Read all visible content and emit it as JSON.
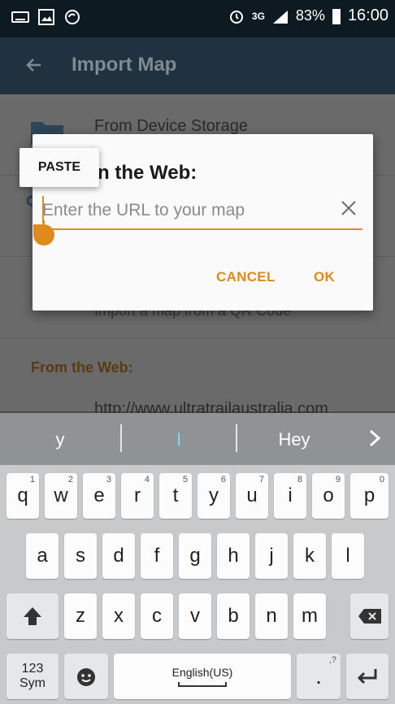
{
  "status_bar": {
    "network": "3G",
    "battery": "83%",
    "time": "16:00"
  },
  "app_bar": {
    "title": "Import Map"
  },
  "background_list": {
    "items": [
      {
        "title": "From Device Storage",
        "subtitle": ""
      },
      {
        "title": "",
        "subtitle": "Import a map from a QR Code"
      }
    ],
    "section_header": "From the Web:",
    "url_text": "http://www.ultratrailaustralia.com"
  },
  "dialog": {
    "title_visible": "n the Web:",
    "input_placeholder": "Enter the URL to your map",
    "cancel_label": "CANCEL",
    "ok_label": "OK"
  },
  "paste_popup": {
    "label": "PASTE"
  },
  "suggestions": {
    "items": [
      "y",
      "I",
      "Hey"
    ]
  },
  "keyboard": {
    "row1": [
      {
        "key": "q",
        "hint": "1"
      },
      {
        "key": "w",
        "hint": "2"
      },
      {
        "key": "e",
        "hint": "3"
      },
      {
        "key": "r",
        "hint": "4"
      },
      {
        "key": "t",
        "hint": "5"
      },
      {
        "key": "y",
        "hint": "6"
      },
      {
        "key": "u",
        "hint": "7"
      },
      {
        "key": "i",
        "hint": "8"
      },
      {
        "key": "o",
        "hint": "9"
      },
      {
        "key": "p",
        "hint": "0"
      }
    ],
    "row2": [
      "a",
      "s",
      "d",
      "f",
      "g",
      "h",
      "j",
      "k",
      "l"
    ],
    "row3": [
      "z",
      "x",
      "c",
      "v",
      "b",
      "n",
      "m"
    ],
    "sym_label_1": "123",
    "sym_label_2": "Sym",
    "space_label": "English(US)",
    "punct_key": ".",
    "punct_hint": ",?"
  },
  "colors": {
    "accent": "#e08a1e",
    "status_bar": "#0e1a22",
    "app_bar": "#203240"
  }
}
